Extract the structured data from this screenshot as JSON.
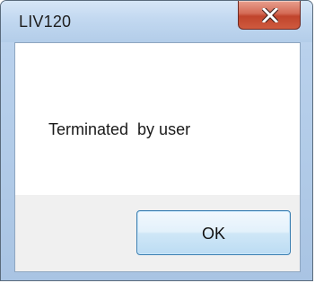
{
  "window": {
    "title": "LIV120",
    "message": "Terminated  by user",
    "close_icon": "close-icon"
  },
  "buttons": {
    "ok_label": "OK"
  },
  "colors": {
    "titlebar": "#c2d8f0",
    "close_button": "#c94a31",
    "client_background": "#f0f0f0",
    "content_background": "#ffffff",
    "ok_border": "#3c7fb1"
  }
}
